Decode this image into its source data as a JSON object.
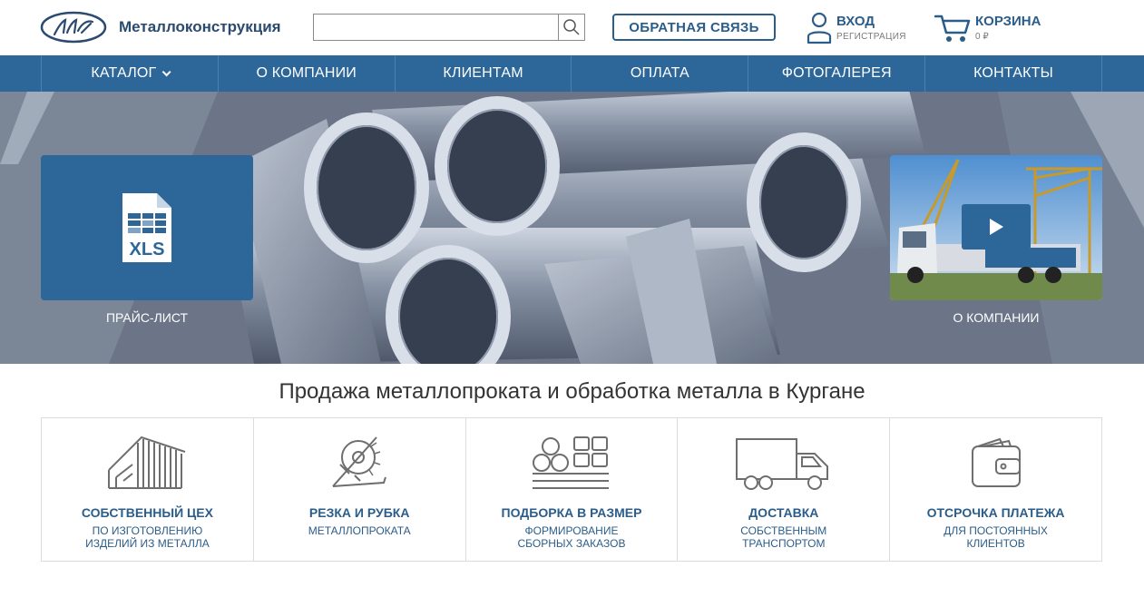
{
  "header": {
    "brand": "Металлоконструкция",
    "search": {
      "value": "",
      "placeholder": ""
    },
    "feedback_label": "ОБРАТНАЯ СВЯЗЬ",
    "login_label": "ВХОД",
    "register_label": "РЕГИСТРАЦИЯ",
    "cart_label": "КОРЗИНА",
    "cart_sum": "0 ₽"
  },
  "nav": {
    "items": [
      {
        "label": "КАТАЛОГ"
      },
      {
        "label": "О КОМПАНИИ"
      },
      {
        "label": "КЛИЕНТАМ"
      },
      {
        "label": "ОПЛАТА"
      },
      {
        "label": "ФОТОГАЛЕРЕЯ"
      },
      {
        "label": "КОНТАКТЫ"
      }
    ]
  },
  "hero": {
    "price_tile_icon_text": "XLS",
    "price_label": "ПРАЙС-ЛИСТ",
    "video_label": "О КОМПАНИИ"
  },
  "main": {
    "title": "Продажа металлопроката и обработка металла в Кургане"
  },
  "features": [
    {
      "title": "СОБСТВЕННЫЙ ЦЕХ",
      "subtitle": "ПО ИЗГОТОВЛЕНИЮ\nИЗДЕЛИЙ ИЗ МЕТАЛЛА",
      "icon": "warehouse-icon"
    },
    {
      "title": "РЕЗКА И РУБКА",
      "subtitle": "МЕТАЛЛОПРОКАТА",
      "icon": "saw-icon"
    },
    {
      "title": "ПОДБОРКА В РАЗМЕР",
      "subtitle": "ФОРМИРОВАНИЕ\nСБОРНЫХ ЗАКАЗОВ",
      "icon": "stacked-profiles-icon"
    },
    {
      "title": "ДОСТАВКА",
      "subtitle": "СОБСТВЕННЫМ\nТРАНСПОРТОМ",
      "icon": "truck-icon"
    },
    {
      "title": "ОТСРОЧКА ПЛАТЕЖА",
      "subtitle": "ДЛЯ ПОСТОЯННЫХ\nКЛИЕНТОВ",
      "icon": "wallet-icon"
    }
  ],
  "colors": {
    "brand_blue": "#2d6799",
    "text_blue": "#2b5d8a"
  }
}
